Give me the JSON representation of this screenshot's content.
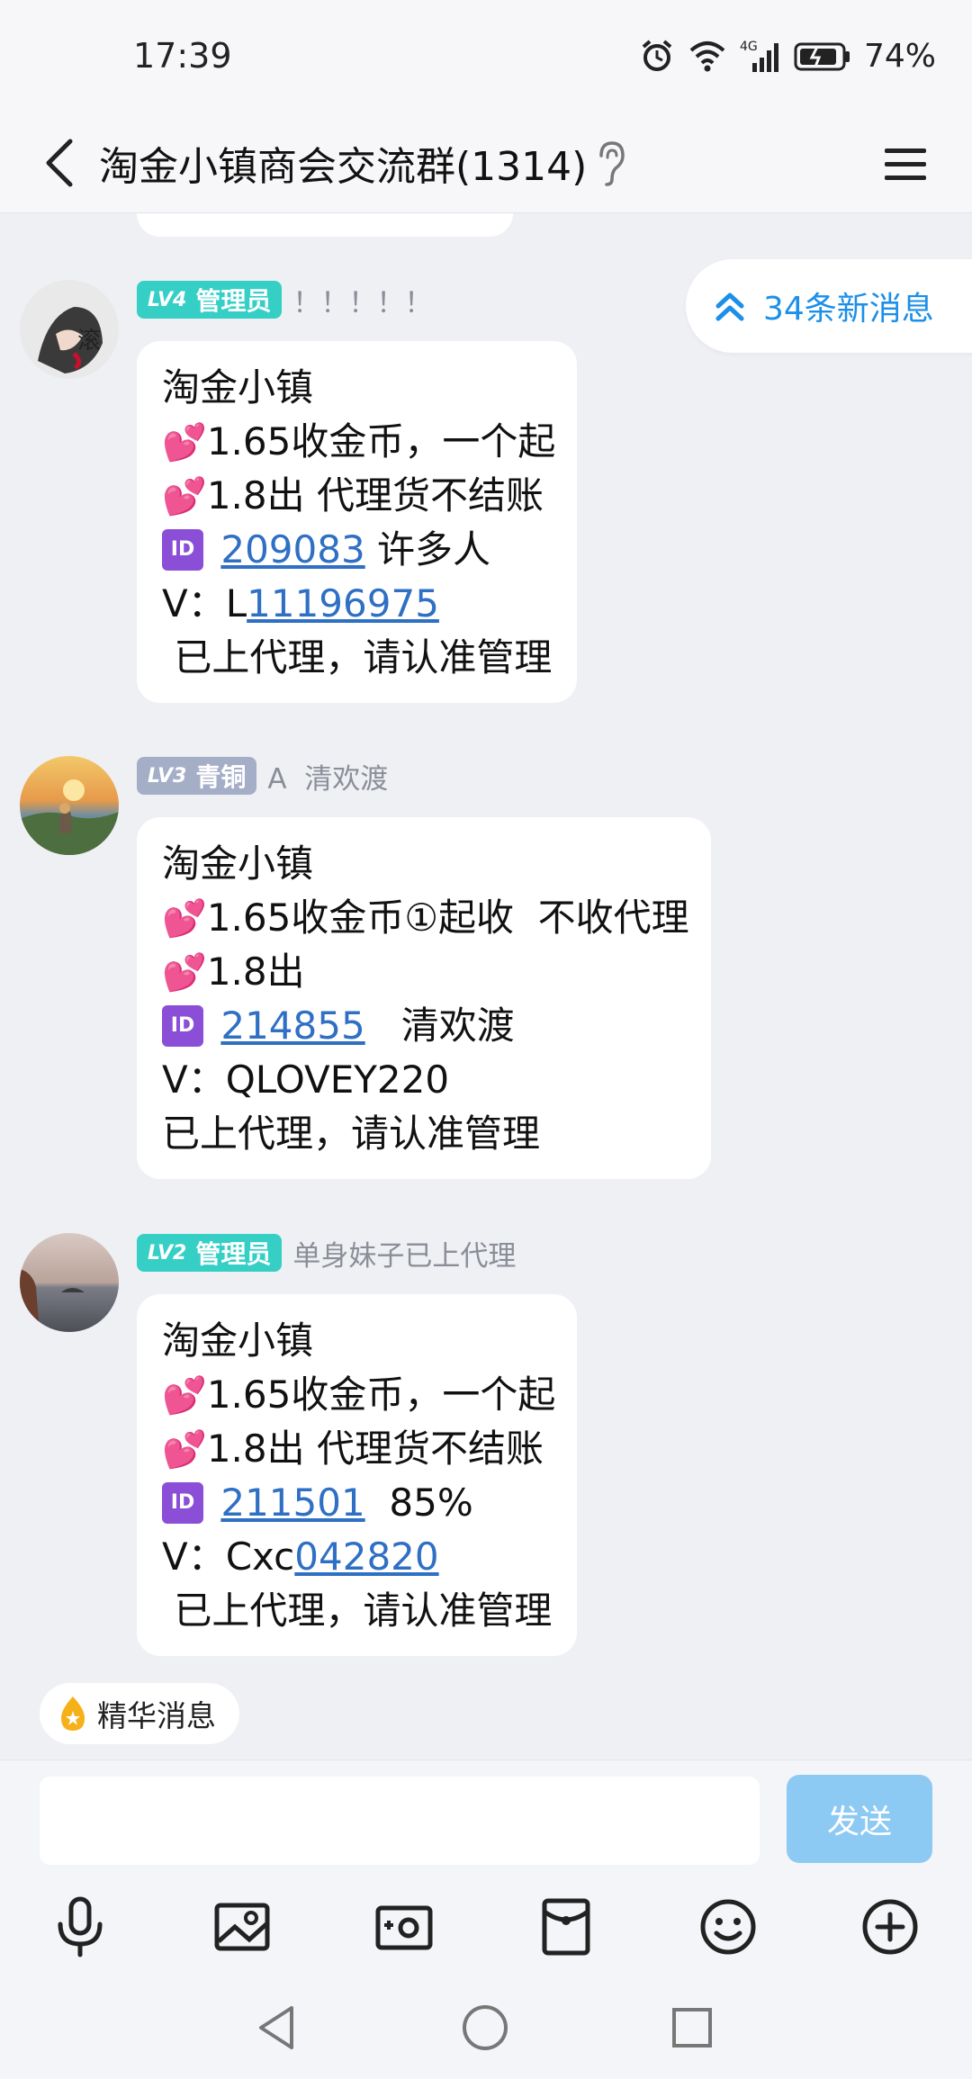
{
  "status_bar": {
    "time": "17:39",
    "network": "4G",
    "battery": "74%"
  },
  "header": {
    "title": "淘金小镇商会交流群(1314)",
    "icons": [
      "back-arrow-icon",
      "ear-icon",
      "menu-icon"
    ]
  },
  "new_messages": {
    "label": "34条新消息",
    "icon": "double-chevron-up-icon"
  },
  "messages": [
    {
      "level": "LV4",
      "role": "管理员",
      "sender": "！！！！！",
      "badge_color": "#35cfc6",
      "lines": {
        "l1": "淘金小镇",
        "l2": "1.65收金币，一个起",
        "l3": "1.8出 代理货不结账",
        "id_label": "ID",
        "id_value": "209083",
        "id_suffix": " 许多人",
        "v_prefix": "V：L",
        "v_link": "11196975",
        "l6": " 已上代理，请认准管理"
      }
    },
    {
      "level": "LV3",
      "role": "青铜",
      "sender": "A  清欢渡",
      "badge_color": "#a5aec7",
      "lines": {
        "l1": "淘金小镇",
        "l2": "1.65收金币①起收  不收代理",
        "l3": "1.8出",
        "id_label": "ID",
        "id_value": "214855",
        "id_suffix": "   清欢渡",
        "v_text": "V：QLOVEY220",
        "l6": "已上代理，请认准管理"
      }
    },
    {
      "level": "LV2",
      "role": "管理员",
      "sender": "单身妹子已上代理",
      "badge_color": "#35cfc6",
      "lines": {
        "l1": "淘金小镇",
        "l2": "1.65收金币，一个起",
        "l3": "1.8出 代理货不结账",
        "id_label": "ID",
        "id_value": "211501",
        "id_suffix": "  85%",
        "v_prefix": "V：Cxc",
        "v_link": "042820",
        "l6": " 已上代理，请认准管理"
      }
    }
  ],
  "essence": {
    "label": "精华消息"
  },
  "composer": {
    "input_value": "",
    "send_label": "发送"
  },
  "toolbar_icons": [
    "microphone-icon",
    "image-icon",
    "camera-icon",
    "red-packet-icon",
    "emoji-icon",
    "plus-icon"
  ],
  "nav_icons": [
    "nav-back-icon",
    "nav-home-icon",
    "nav-recents-icon"
  ],
  "colors": {
    "accent": "#1c8fe8",
    "link": "#2f6fc4",
    "send_disabled": "#8dcaf3",
    "badge_admin": "#35cfc6",
    "badge_bronze": "#a5aec7"
  }
}
